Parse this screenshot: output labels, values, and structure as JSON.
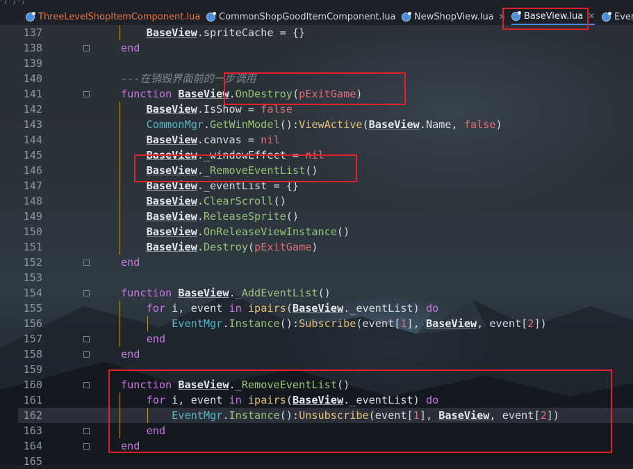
{
  "breadcrumb": "· / · / · /",
  "tabs": [
    {
      "label": "ThreeLevelShopItemComponent.lua",
      "close": "✕",
      "state": "modified",
      "icon": "lua-file-icon"
    },
    {
      "label": "CommonShopGoodItemComponent.lua",
      "close": "✕",
      "state": "normal",
      "icon": "lua-file-icon"
    },
    {
      "label": "NewShopView.lua",
      "close": "✕",
      "state": "normal",
      "icon": "lua-file-icon"
    },
    {
      "label": "BaseView.lua",
      "close": "✕",
      "state": "active",
      "icon": "lua-file-icon"
    },
    {
      "label": "Even",
      "close": "",
      "state": "normal",
      "icon": "lua-file-icon"
    }
  ],
  "lines": [
    {
      "n": "137",
      "text": "    BaseView.spriteCache = {}"
    },
    {
      "n": "138",
      "text": "end"
    },
    {
      "n": "139",
      "text": ""
    },
    {
      "n": "140",
      "text": "---在销毁界面前的一步调用"
    },
    {
      "n": "141",
      "text": "function BaseView.OnDestroy(pExitGame)"
    },
    {
      "n": "142",
      "text": "    BaseView.IsShow = false"
    },
    {
      "n": "143",
      "text": "    CommonMgr.GetWinModel():ViewActive(BaseView.Name, false)"
    },
    {
      "n": "144",
      "text": "    BaseView.canvas = nil"
    },
    {
      "n": "145",
      "text": "    BaseView._windowEffect = nil"
    },
    {
      "n": "146",
      "text": "    BaseView._RemoveEventList()"
    },
    {
      "n": "147",
      "text": "    BaseView._eventList = {}"
    },
    {
      "n": "148",
      "text": "    BaseView.ClearScroll()"
    },
    {
      "n": "149",
      "text": "    BaseView.ReleaseSprite()"
    },
    {
      "n": "150",
      "text": "    BaseView.OnReleaseViewInstance()"
    },
    {
      "n": "151",
      "text": "    BaseView.Destroy(pExitGame)"
    },
    {
      "n": "152",
      "text": "end"
    },
    {
      "n": "153",
      "text": ""
    },
    {
      "n": "154",
      "text": "function BaseView._AddEventList()"
    },
    {
      "n": "155",
      "text": "    for i, event in ipairs(BaseView._eventList) do"
    },
    {
      "n": "156",
      "text": "        EventMgr.Instance():Subscribe(event[1], BaseView, event[2])"
    },
    {
      "n": "157",
      "text": "    end"
    },
    {
      "n": "158",
      "text": "end"
    },
    {
      "n": "159",
      "text": ""
    },
    {
      "n": "160",
      "text": "function BaseView._RemoveEventList()"
    },
    {
      "n": "161",
      "text": "    for i, event in ipairs(BaseView._eventList) do"
    },
    {
      "n": "162",
      "text": "        EventMgr.Instance():Unsubscribe(event[1], BaseView, event[2])"
    },
    {
      "n": "163",
      "text": "    end"
    },
    {
      "n": "164",
      "text": "end"
    },
    {
      "n": "165",
      "text": ""
    }
  ],
  "current_line": "162",
  "colors": {
    "keyword": "#c678dd",
    "function_name": "#98c379",
    "method": "#e5c07b",
    "literal": "#e06c75",
    "comment": "#7f848e",
    "annotation_box": "#e0202a",
    "active_tab_underline": "#4b8ad6"
  }
}
